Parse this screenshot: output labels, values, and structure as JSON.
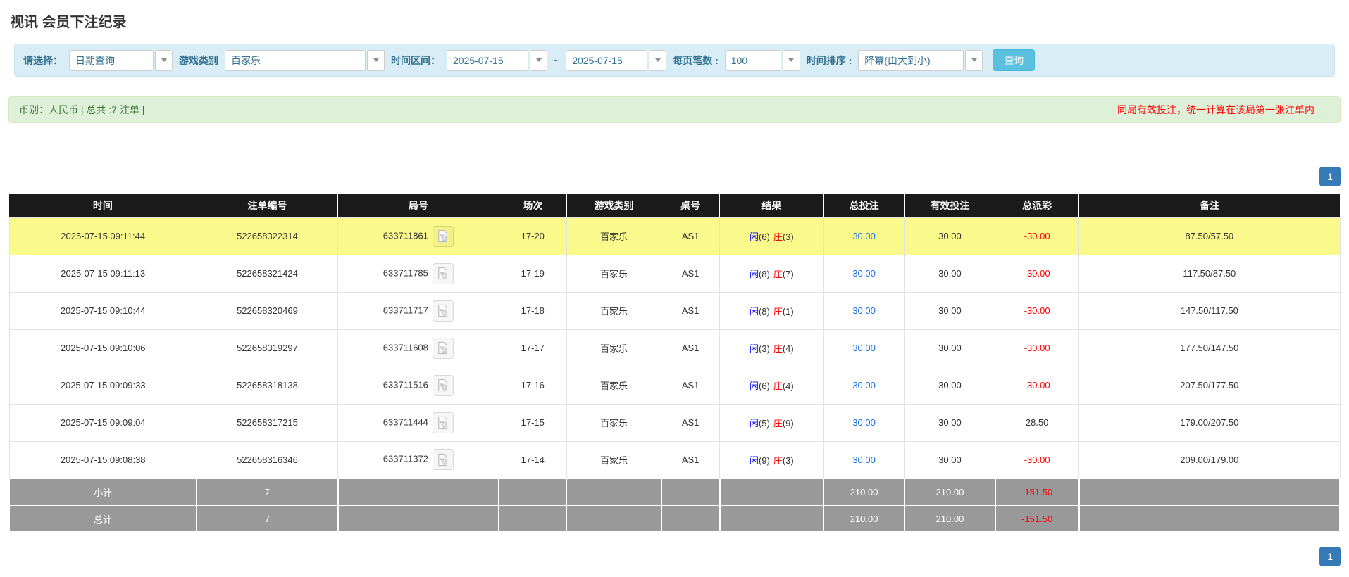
{
  "page_title": "视讯 会员下注纪录",
  "filter_bar": {
    "select_label": "请选择：",
    "select_value": "日期查询",
    "game_label": "游戏类别",
    "game_value": "百家乐",
    "range_label": "时间区间：",
    "date_from": "2025-07-15",
    "tilde": "~",
    "date_to": "2025-07-15",
    "page_size_label": "每页笔数 :",
    "page_size_value": "100",
    "sort_label": "时间排序 :",
    "sort_value": "降冪(由大到小)",
    "search_button_label": "查询"
  },
  "summary_bar": {
    "currency_text": "币别：人民币 | 总共 :7 注单 |",
    "notice_text": "同局有效投注，统一计算在该局第一张注单内"
  },
  "pagination": {
    "current_page": "1"
  },
  "table": {
    "headers": [
      "时间",
      "注单编号",
      "局号",
      "场次",
      "游戏类别",
      "桌号",
      "结果",
      "总投注",
      "有效投注",
      "总派彩",
      "备注"
    ],
    "result_labels": {
      "player": "闲",
      "banker": "庄"
    },
    "rows": [
      {
        "time": "2025-07-15 09:11:44",
        "bet_no": "522658322314",
        "round_no": "633711861",
        "session": "17-20",
        "game": "百家乐",
        "table_no": "AS1",
        "player_score": "(6)",
        "banker_score": "(3)",
        "total_bet": "30.00",
        "valid_bet": "30.00",
        "payout": "-30.00",
        "remark": "87.50/57.50",
        "highlighted": true
      },
      {
        "time": "2025-07-15 09:11:13",
        "bet_no": "522658321424",
        "round_no": "633711785",
        "session": "17-19",
        "game": "百家乐",
        "table_no": "AS1",
        "player_score": "(8)",
        "banker_score": "(7)",
        "total_bet": "30.00",
        "valid_bet": "30.00",
        "payout": "-30.00",
        "remark": "117.50/87.50",
        "highlighted": false
      },
      {
        "time": "2025-07-15 09:10:44",
        "bet_no": "522658320469",
        "round_no": "633711717",
        "session": "17-18",
        "game": "百家乐",
        "table_no": "AS1",
        "player_score": "(8)",
        "banker_score": "(1)",
        "total_bet": "30.00",
        "valid_bet": "30.00",
        "payout": "-30.00",
        "remark": "147.50/117.50",
        "highlighted": false
      },
      {
        "time": "2025-07-15 09:10:06",
        "bet_no": "522658319297",
        "round_no": "633711608",
        "session": "17-17",
        "game": "百家乐",
        "table_no": "AS1",
        "player_score": "(3)",
        "banker_score": "(4)",
        "total_bet": "30.00",
        "valid_bet": "30.00",
        "payout": "-30.00",
        "remark": "177.50/147.50",
        "highlighted": false
      },
      {
        "time": "2025-07-15 09:09:33",
        "bet_no": "522658318138",
        "round_no": "633711516",
        "session": "17-16",
        "game": "百家乐",
        "table_no": "AS1",
        "player_score": "(6)",
        "banker_score": "(4)",
        "total_bet": "30.00",
        "valid_bet": "30.00",
        "payout": "-30.00",
        "remark": "207.50/177.50",
        "highlighted": false
      },
      {
        "time": "2025-07-15 09:09:04",
        "bet_no": "522658317215",
        "round_no": "633711444",
        "session": "17-15",
        "game": "百家乐",
        "table_no": "AS1",
        "player_score": "(5)",
        "banker_score": "(9)",
        "total_bet": "30.00",
        "valid_bet": "30.00",
        "payout": "28.50",
        "remark": "179.00/207.50",
        "highlighted": false
      },
      {
        "time": "2025-07-15 09:08:38",
        "bet_no": "522658316346",
        "round_no": "633711372",
        "session": "17-14",
        "game": "百家乐",
        "table_no": "AS1",
        "player_score": "(9)",
        "banker_score": "(3)",
        "total_bet": "30.00",
        "valid_bet": "30.00",
        "payout": "-30.00",
        "remark": "209.00/179.00",
        "highlighted": false
      }
    ],
    "footer_rows": [
      {
        "label": "小计",
        "count": "7",
        "total_bet": "210.00",
        "valid_bet": "210.00",
        "payout": "-151.50"
      },
      {
        "label": "总计",
        "count": "7",
        "total_bet": "210.00",
        "valid_bet": "210.00",
        "payout": "-151.50"
      }
    ]
  },
  "colors": {
    "search_button_blue": "#5bc0de",
    "pagination_active_blue": "#337ab7",
    "highlight_yellow": "#fafa8c",
    "player_blue": "#0000ff",
    "banker_red": "#ff0000",
    "negative_red": "#ff0000",
    "bet_link_blue": "#1a6fe8",
    "header_black": "#1b1b1b",
    "footer_gray": "#999999",
    "filter_bar_blue": "#d9edf7",
    "summary_bar_green": "#dff0d8"
  }
}
